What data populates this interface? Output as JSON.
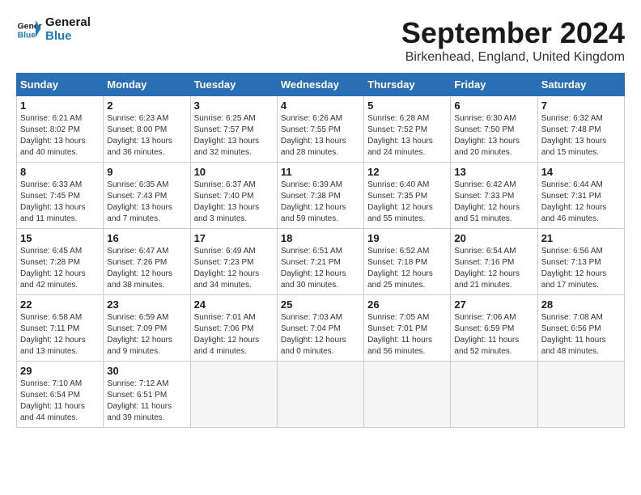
{
  "header": {
    "logo_general": "General",
    "logo_blue": "Blue",
    "month_title": "September 2024",
    "location": "Birkenhead, England, United Kingdom"
  },
  "days_of_week": [
    "Sunday",
    "Monday",
    "Tuesday",
    "Wednesday",
    "Thursday",
    "Friday",
    "Saturday"
  ],
  "weeks": [
    [
      {
        "day": "1",
        "info": "Sunrise: 6:21 AM\nSunset: 8:02 PM\nDaylight: 13 hours\nand 40 minutes."
      },
      {
        "day": "2",
        "info": "Sunrise: 6:23 AM\nSunset: 8:00 PM\nDaylight: 13 hours\nand 36 minutes."
      },
      {
        "day": "3",
        "info": "Sunrise: 6:25 AM\nSunset: 7:57 PM\nDaylight: 13 hours\nand 32 minutes."
      },
      {
        "day": "4",
        "info": "Sunrise: 6:26 AM\nSunset: 7:55 PM\nDaylight: 13 hours\nand 28 minutes."
      },
      {
        "day": "5",
        "info": "Sunrise: 6:28 AM\nSunset: 7:52 PM\nDaylight: 13 hours\nand 24 minutes."
      },
      {
        "day": "6",
        "info": "Sunrise: 6:30 AM\nSunset: 7:50 PM\nDaylight: 13 hours\nand 20 minutes."
      },
      {
        "day": "7",
        "info": "Sunrise: 6:32 AM\nSunset: 7:48 PM\nDaylight: 13 hours\nand 15 minutes."
      }
    ],
    [
      {
        "day": "8",
        "info": "Sunrise: 6:33 AM\nSunset: 7:45 PM\nDaylight: 13 hours\nand 11 minutes."
      },
      {
        "day": "9",
        "info": "Sunrise: 6:35 AM\nSunset: 7:43 PM\nDaylight: 13 hours\nand 7 minutes."
      },
      {
        "day": "10",
        "info": "Sunrise: 6:37 AM\nSunset: 7:40 PM\nDaylight: 13 hours\nand 3 minutes."
      },
      {
        "day": "11",
        "info": "Sunrise: 6:39 AM\nSunset: 7:38 PM\nDaylight: 12 hours\nand 59 minutes."
      },
      {
        "day": "12",
        "info": "Sunrise: 6:40 AM\nSunset: 7:35 PM\nDaylight: 12 hours\nand 55 minutes."
      },
      {
        "day": "13",
        "info": "Sunrise: 6:42 AM\nSunset: 7:33 PM\nDaylight: 12 hours\nand 51 minutes."
      },
      {
        "day": "14",
        "info": "Sunrise: 6:44 AM\nSunset: 7:31 PM\nDaylight: 12 hours\nand 46 minutes."
      }
    ],
    [
      {
        "day": "15",
        "info": "Sunrise: 6:45 AM\nSunset: 7:28 PM\nDaylight: 12 hours\nand 42 minutes."
      },
      {
        "day": "16",
        "info": "Sunrise: 6:47 AM\nSunset: 7:26 PM\nDaylight: 12 hours\nand 38 minutes."
      },
      {
        "day": "17",
        "info": "Sunrise: 6:49 AM\nSunset: 7:23 PM\nDaylight: 12 hours\nand 34 minutes."
      },
      {
        "day": "18",
        "info": "Sunrise: 6:51 AM\nSunset: 7:21 PM\nDaylight: 12 hours\nand 30 minutes."
      },
      {
        "day": "19",
        "info": "Sunrise: 6:52 AM\nSunset: 7:18 PM\nDaylight: 12 hours\nand 25 minutes."
      },
      {
        "day": "20",
        "info": "Sunrise: 6:54 AM\nSunset: 7:16 PM\nDaylight: 12 hours\nand 21 minutes."
      },
      {
        "day": "21",
        "info": "Sunrise: 6:56 AM\nSunset: 7:13 PM\nDaylight: 12 hours\nand 17 minutes."
      }
    ],
    [
      {
        "day": "22",
        "info": "Sunrise: 6:58 AM\nSunset: 7:11 PM\nDaylight: 12 hours\nand 13 minutes."
      },
      {
        "day": "23",
        "info": "Sunrise: 6:59 AM\nSunset: 7:09 PM\nDaylight: 12 hours\nand 9 minutes."
      },
      {
        "day": "24",
        "info": "Sunrise: 7:01 AM\nSunset: 7:06 PM\nDaylight: 12 hours\nand 4 minutes."
      },
      {
        "day": "25",
        "info": "Sunrise: 7:03 AM\nSunset: 7:04 PM\nDaylight: 12 hours\nand 0 minutes."
      },
      {
        "day": "26",
        "info": "Sunrise: 7:05 AM\nSunset: 7:01 PM\nDaylight: 11 hours\nand 56 minutes."
      },
      {
        "day": "27",
        "info": "Sunrise: 7:06 AM\nSunset: 6:59 PM\nDaylight: 11 hours\nand 52 minutes."
      },
      {
        "day": "28",
        "info": "Sunrise: 7:08 AM\nSunset: 6:56 PM\nDaylight: 11 hours\nand 48 minutes."
      }
    ],
    [
      {
        "day": "29",
        "info": "Sunrise: 7:10 AM\nSunset: 6:54 PM\nDaylight: 11 hours\nand 44 minutes."
      },
      {
        "day": "30",
        "info": "Sunrise: 7:12 AM\nSunset: 6:51 PM\nDaylight: 11 hours\nand 39 minutes."
      },
      {
        "day": "",
        "info": ""
      },
      {
        "day": "",
        "info": ""
      },
      {
        "day": "",
        "info": ""
      },
      {
        "day": "",
        "info": ""
      },
      {
        "day": "",
        "info": ""
      }
    ]
  ]
}
